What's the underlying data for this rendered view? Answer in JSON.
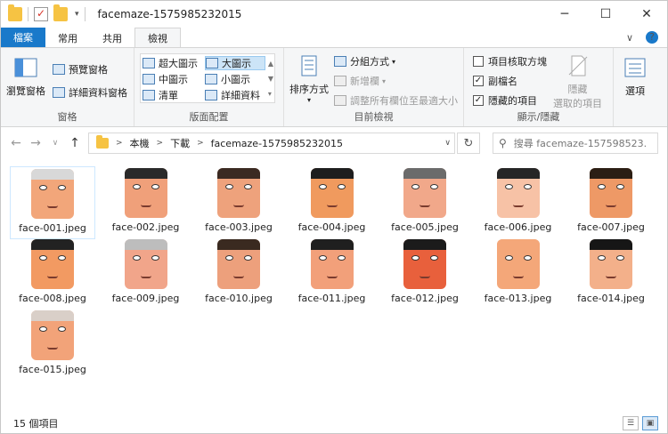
{
  "title_bar": {
    "folder_name": "facemaze-1575985232015",
    "minimize": "─",
    "maximize": "☐",
    "close": "✕"
  },
  "ribbon_tabs": {
    "file": "檔案",
    "home": "常用",
    "share": "共用",
    "view": "檢視",
    "expand_icon": "∨",
    "help_icon": "?"
  },
  "ribbon": {
    "panes": {
      "navigation_pane": "瀏覽窗格",
      "preview_pane": "預覽窗格",
      "details_pane": "詳細資料窗格",
      "label": "窗格"
    },
    "layout": {
      "extra_large": "超大圖示",
      "large": "大圖示",
      "medium": "中圖示",
      "small": "小圖示",
      "list": "清單",
      "details": "詳細資料",
      "label": "版面配置"
    },
    "current_view": {
      "sort_by": "排序方式",
      "group_by": "分組方式",
      "add_columns": "新增欄",
      "size_all_columns": "調整所有欄位至最適大小",
      "label": "目前檢視"
    },
    "show_hide": {
      "item_check_boxes": "項目核取方塊",
      "file_name_extensions": "副檔名",
      "hidden_items": "隱藏的項目",
      "hide_selected_1": "隱藏",
      "hide_selected_2": "選取的項目",
      "label": "顯示/隱藏"
    },
    "options": "選項"
  },
  "address_bar": {
    "breadcrumb": [
      "本機",
      "下載",
      "facemaze-1575985232015"
    ],
    "search_placeholder": "搜尋 facemaze-157598523..."
  },
  "files": [
    {
      "name": "face-001.jpeg",
      "skin": "#f2a67a",
      "hair": "#d8d8d8"
    },
    {
      "name": "face-002.jpeg",
      "skin": "#f0a07a",
      "hair": "#2a2a2a"
    },
    {
      "name": "face-003.jpeg",
      "skin": "#eea27c",
      "hair": "#3b2a22"
    },
    {
      "name": "face-004.jpeg",
      "skin": "#f09a5e",
      "hair": "#1e1e1e"
    },
    {
      "name": "face-005.jpeg",
      "skin": "#f1a88a",
      "hair": "#6b6b6b"
    },
    {
      "name": "face-006.jpeg",
      "skin": "#f7c2a6",
      "hair": "#262626"
    },
    {
      "name": "face-007.jpeg",
      "skin": "#ee9966",
      "hair": "#2b1e14"
    },
    {
      "name": "face-008.jpeg",
      "skin": "#f29a62",
      "hair": "#222222"
    },
    {
      "name": "face-009.jpeg",
      "skin": "#f1a58a",
      "hair": "#bdbdbd"
    },
    {
      "name": "face-010.jpeg",
      "skin": "#eda07c",
      "hair": "#3a2a20"
    },
    {
      "name": "face-011.jpeg",
      "skin": "#f2a07a",
      "hair": "#1f1f1f"
    },
    {
      "name": "face-012.jpeg",
      "skin": "#e8603c",
      "hair": "#1b1b1b"
    },
    {
      "name": "face-013.jpeg",
      "skin": "#f4a779",
      "hair": "#f4a779"
    },
    {
      "name": "face-014.jpeg",
      "skin": "#f3b08a",
      "hair": "#161616"
    },
    {
      "name": "face-015.jpeg",
      "skin": "#f2a379",
      "hair": "#d9cfc8"
    }
  ],
  "status_bar": {
    "item_count": "15 個項目"
  }
}
